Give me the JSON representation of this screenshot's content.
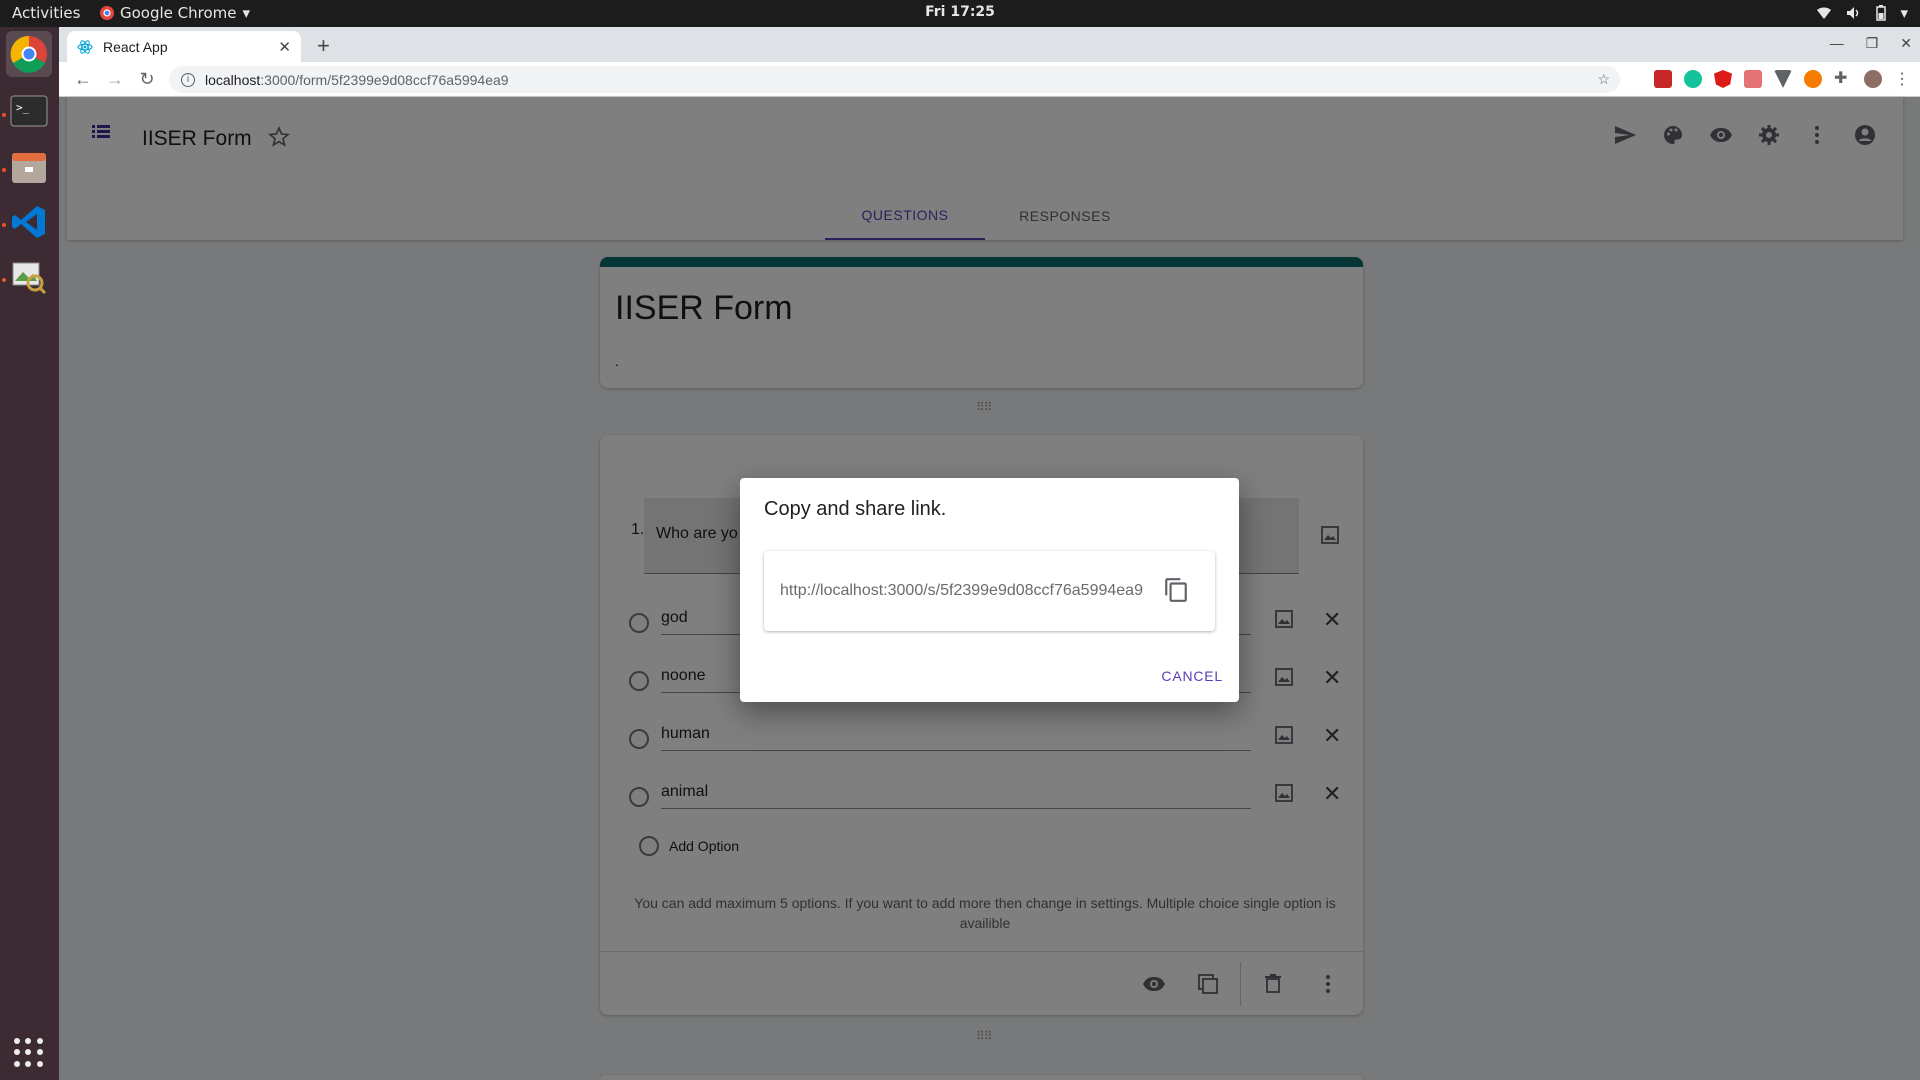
{
  "topbar": {
    "activities": "Activities",
    "app_menu": "Google Chrome",
    "clock": "Fri 17:25"
  },
  "browser": {
    "tab_title": "React App",
    "url_host": "localhost",
    "url_path": ":3000/form/5f2399e9d08ccf76a5994ea9"
  },
  "header": {
    "form_title": "IISER Form",
    "tabs": [
      "QUESTIONS",
      "RESPONSES"
    ]
  },
  "form": {
    "title": "IISER Form",
    "description": "."
  },
  "question": {
    "number": "1.",
    "text": "Who are yo",
    "options": [
      "god",
      "noone",
      "human",
      "animal"
    ],
    "add_option": "Add Option",
    "hint": "You can add maximum 5 options. If you want to add more then change in settings. Multiple choice single option is availible"
  },
  "dialog": {
    "title": "Copy and share link.",
    "link": "http://localhost:3000/s/5f2399e9d08ccf76a5994ea9",
    "cancel": "CANCEL"
  },
  "colors": {
    "accent": "#5b3fb7",
    "form_top_border": "#0a6b6b",
    "dock": "#3d2b34"
  }
}
